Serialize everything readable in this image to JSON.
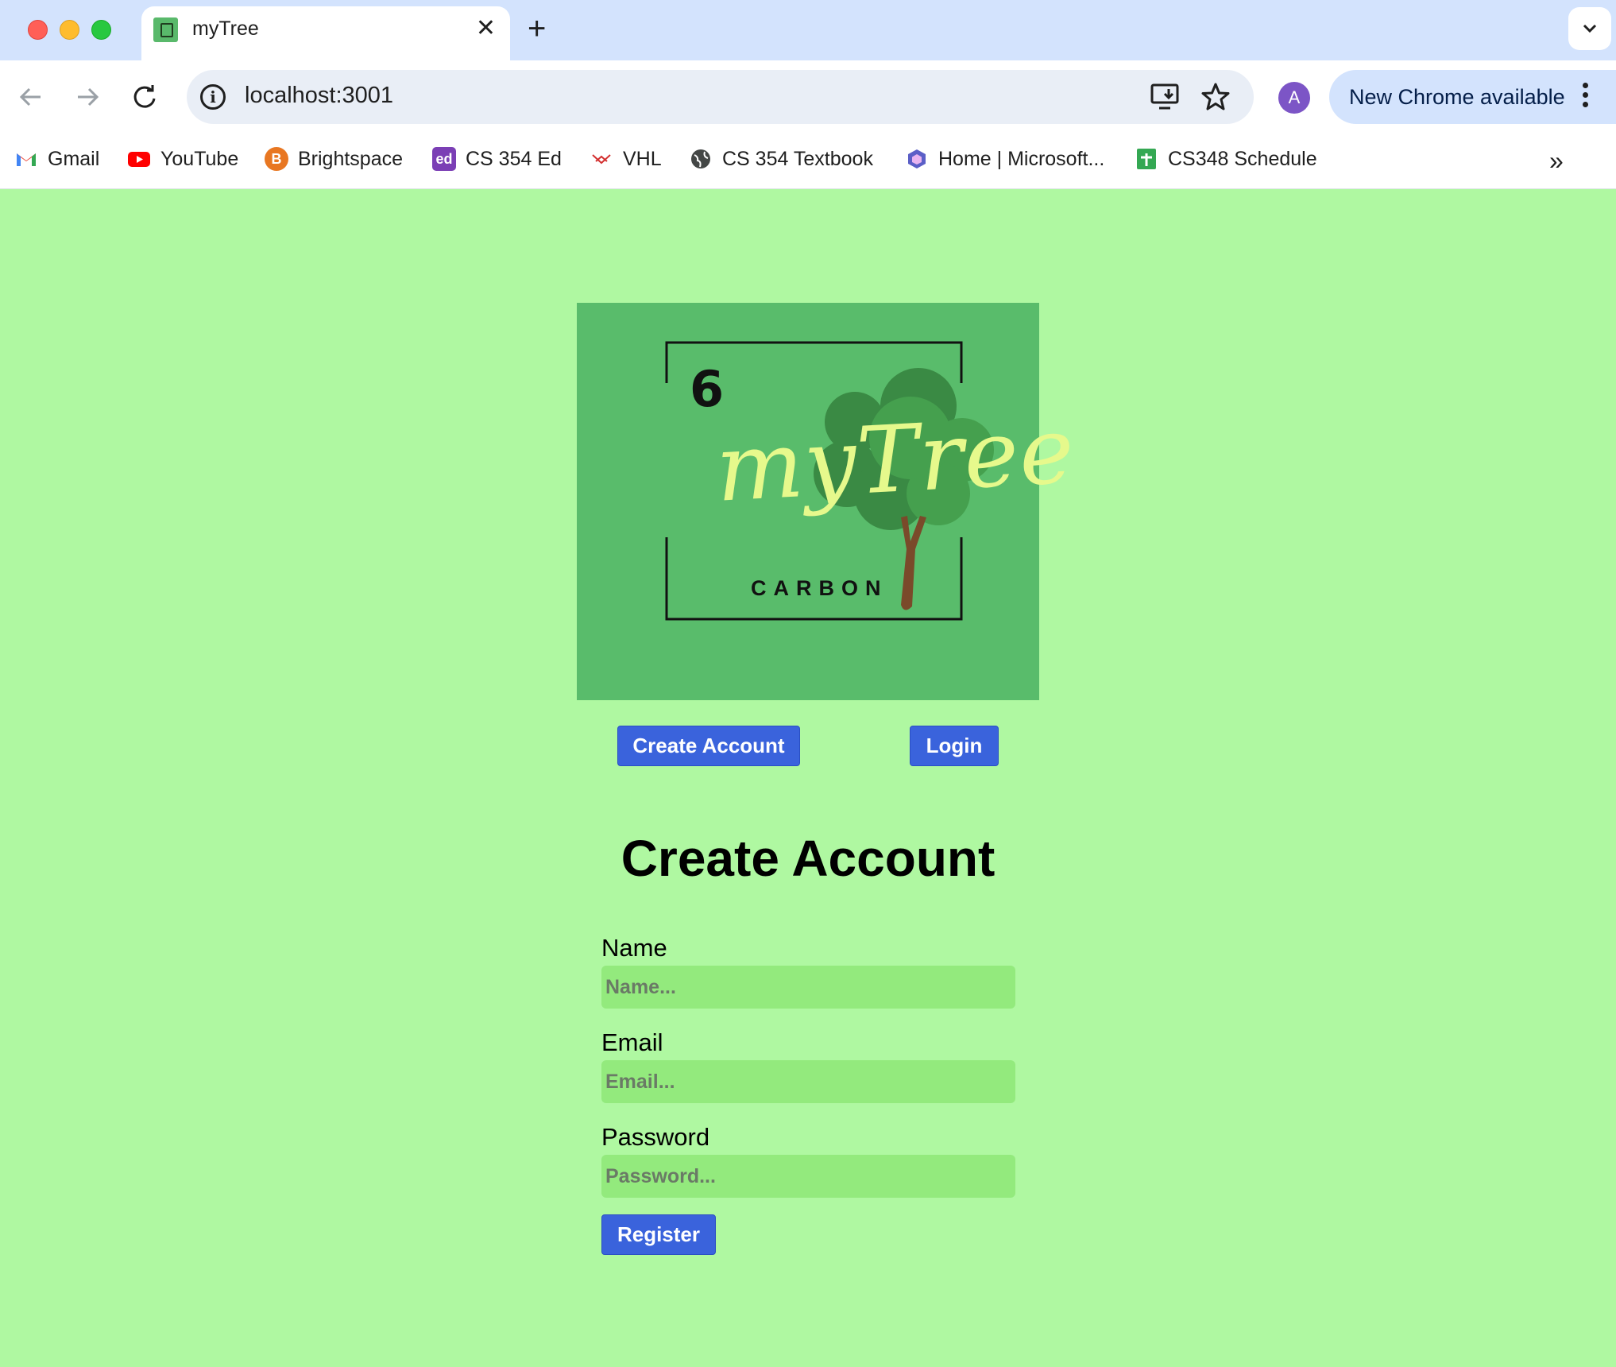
{
  "browser": {
    "tab_title": "myTree",
    "url": "localhost:3001",
    "profile_initial": "A",
    "update_label": "New Chrome available",
    "bookmarks": [
      {
        "label": "Gmail",
        "icon": "gmail-icon",
        "color": "#ea4335"
      },
      {
        "label": "YouTube",
        "icon": "youtube-icon",
        "color": "#ff0000"
      },
      {
        "label": "Brightspace",
        "icon": "brightspace-icon",
        "color": "#e87722"
      },
      {
        "label": "CS 354 Ed",
        "icon": "ed-icon",
        "color": "#7b3fb5"
      },
      {
        "label": "VHL",
        "icon": "vhl-icon",
        "color": "#d32f2f"
      },
      {
        "label": "CS 354 Textbook",
        "icon": "globe-icon",
        "color": "#444746"
      },
      {
        "label": "Home | Microsoft...",
        "icon": "microsoft365-icon",
        "color": "#5b5fc7"
      },
      {
        "label": "CS348 Schedule",
        "icon": "sheets-icon",
        "color": "#34a853"
      }
    ]
  },
  "logo": {
    "number": "6",
    "wordmark": "myTree",
    "subtitle": "CARBON"
  },
  "nav": {
    "create_label": "Create Account",
    "login_label": "Login"
  },
  "form": {
    "heading": "Create Account",
    "name_label": "Name",
    "name_placeholder": "Name...",
    "email_label": "Email",
    "email_placeholder": "Email...",
    "password_label": "Password",
    "password_placeholder": "Password...",
    "submit_label": "Register"
  },
  "colors": {
    "page_background": "#aff8a1",
    "logo_background": "#59bc6b",
    "button": "#3a63dc",
    "input_background": "#93ea7d"
  }
}
